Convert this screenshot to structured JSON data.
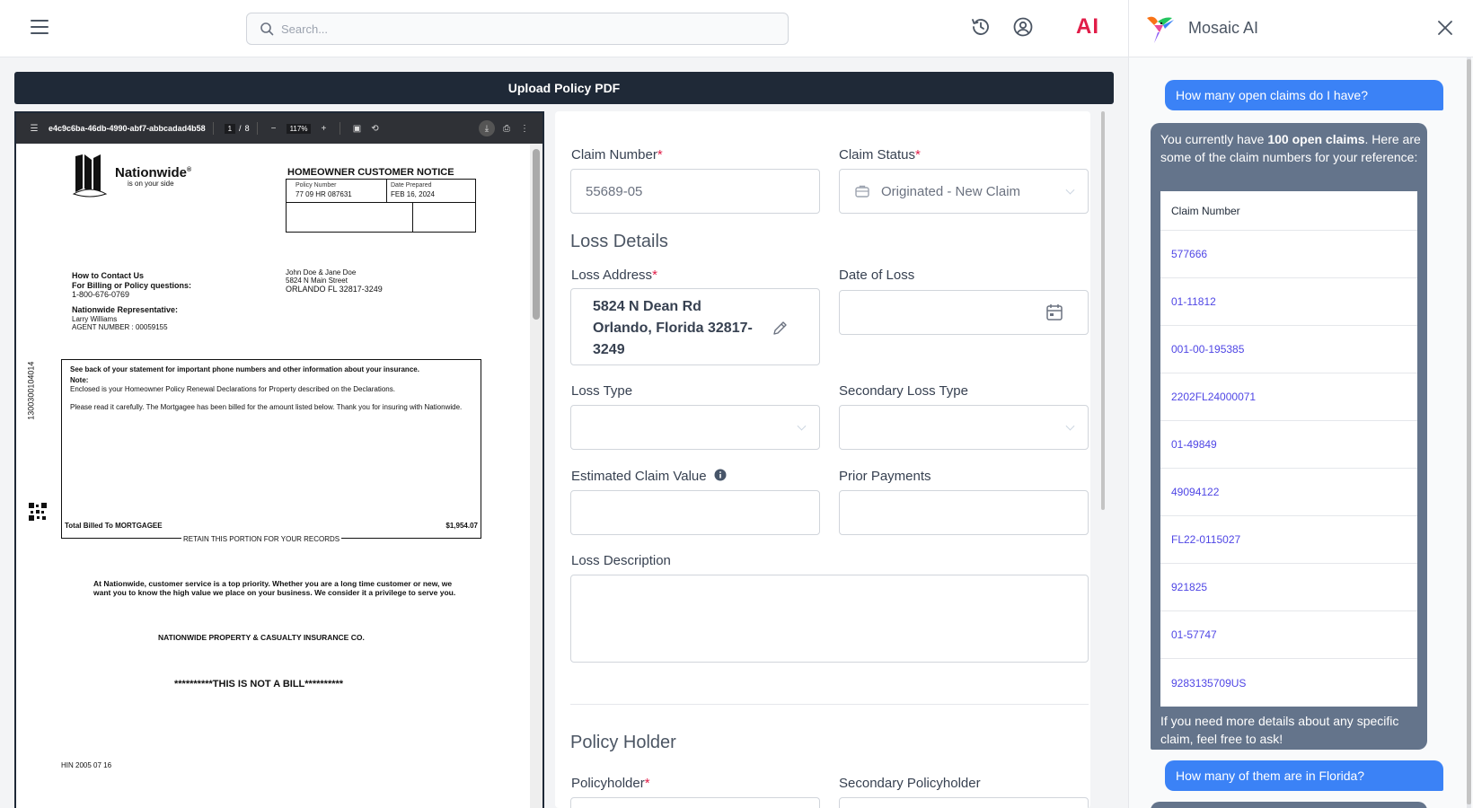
{
  "topbar": {
    "search_placeholder": "Search...",
    "ai_label": "AI"
  },
  "upload_bar": {
    "label": "Upload Policy PDF"
  },
  "pdf": {
    "toolbar": {
      "file_id": "e4c9c6ba-46db-4990-abf7-abbcadad4b58",
      "page_current": "1",
      "page_separator": "/",
      "page_total": "8",
      "zoom": "117%"
    },
    "page": {
      "brand": "Nationwide",
      "brand_reg": "®",
      "tagline": "is on your side",
      "notice_title": "HOMEOWNER CUSTOMER NOTICE",
      "policy_number_label": "Policy Number",
      "policy_number": "77 09 HR 087631",
      "date_prepared_label": "Date Prepared",
      "date_prepared": "FEB 16, 2024",
      "contact_heading": "How to Contact Us",
      "contact_sub": "For Billing or Policy questions:",
      "contact_phone": "1-800-676-0769",
      "rep_heading": "Nationwide Representative:",
      "rep_name": "Larry Williams",
      "agent_number": "AGENT NUMBER : 00059155",
      "addressee_names": "John Doe & Jane Doe",
      "addressee_street": "5824 N Main Street",
      "addressee_city": "ORLANDO FL 32817-3249",
      "side_code": "1300300104014",
      "statement_bold": "See back of your statement for important phone numbers and other information about your insurance.",
      "note_label": "Note:",
      "note_text": "Enclosed is your Homeowner Policy Renewal Declarations for Property described on the Declarations.",
      "please_read": "Please read it carefully. The Mortgagee has been billed for the amount listed below. Thank you for insuring with Nationwide.",
      "total_label": "Total Billed To MORTGAGEE",
      "total_amount": "$1,954.07",
      "retain_text": "RETAIN THIS PORTION FOR YOUR RECORDS",
      "service_text": "At Nationwide, customer service is a top priority. Whether you are a long time customer or new, we want you to know the high value we place on your business. We consider it a privilege to serve you.",
      "company": "NATIONWIDE PROPERTY & CASUALTY INSURANCE CO.",
      "not_bill": "**********THIS IS NOT A BILL**********",
      "footer_code": "HIN 2005 07 16"
    }
  },
  "form": {
    "claim_number_label": "Claim Number",
    "claim_number_value": "55689-05",
    "claim_status_label": "Claim Status",
    "claim_status_value": "Originated - New Claim",
    "loss_details_title": "Loss Details",
    "loss_address_label": "Loss Address",
    "loss_address_line1": "5824 N Dean Rd",
    "loss_address_line2": "Orlando, Florida 32817-",
    "loss_address_line3": "3249",
    "date_of_loss_label": "Date of Loss",
    "loss_type_label": "Loss Type",
    "secondary_loss_type_label": "Secondary Loss Type",
    "estimated_value_label": "Estimated Claim Value",
    "prior_payments_label": "Prior Payments",
    "loss_description_label": "Loss Description",
    "policy_holder_title": "Policy Holder",
    "policyholder_label": "Policyholder",
    "secondary_policyholder_label": "Secondary Policyholder",
    "required_mark": "*"
  },
  "chat": {
    "title": "Mosaic AI",
    "messages": {
      "q1": "How many open claims do I have?",
      "a1_prefix": "You currently have ",
      "a1_bold": "100 open claims",
      "a1_suffix": ". Here are some of the claim numbers for your reference:",
      "table_header": "Claim Number",
      "claims": [
        "577666",
        "01-11812",
        "001-00-195385",
        "2202FL24000071",
        "01-49849",
        "49094122",
        "FL22-0115027",
        "921825",
        "01-57747",
        "9283135709US"
      ],
      "a1_footer": "If you need more details about any specific claim, feel free to ask!",
      "q2": "How many of them are in Florida?"
    }
  },
  "colors": {
    "accent": "#3b82f6",
    "bot_bubble": "#64748b",
    "required": "#e11d48",
    "dark_bar": "#1f2937",
    "link": "#4f46e5"
  },
  "icons": [
    "menu-icon",
    "search-icon",
    "history-icon",
    "user-circle-icon",
    "close-icon",
    "briefcase-icon",
    "calendar-icon",
    "pencil-icon",
    "info-icon",
    "hummingbird-logo"
  ]
}
